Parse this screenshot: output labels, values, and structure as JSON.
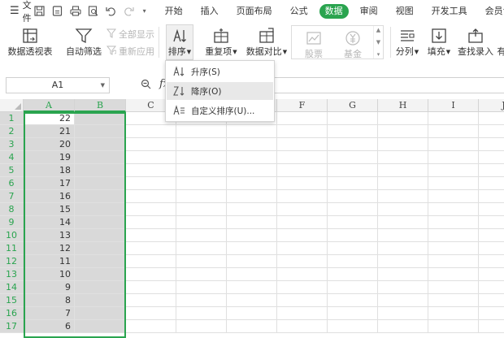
{
  "menubar": {
    "file_label": "文件",
    "tabs": [
      {
        "label": "开始",
        "active": false
      },
      {
        "label": "插入",
        "active": false
      },
      {
        "label": "页面布局",
        "active": false
      },
      {
        "label": "公式",
        "active": false
      },
      {
        "label": "数据",
        "active": true
      },
      {
        "label": "审阅",
        "active": false
      },
      {
        "label": "视图",
        "active": false
      },
      {
        "label": "开发工具",
        "active": false
      },
      {
        "label": "会员专享",
        "active": false
      }
    ],
    "accent_color": "#2aa44f"
  },
  "ribbon": {
    "pivot_table": "数据透视表",
    "auto_filter": "自动筛选",
    "show_all": "全部显示",
    "reapply": "重新应用",
    "sort": "排序",
    "duplicates": "重复项",
    "compare": "数据对比",
    "stocks": "股票",
    "funds": "基金",
    "split": "分列",
    "fill": "填充",
    "find_entry": "查找录入",
    "more": "有"
  },
  "formula_bar": {
    "cell_ref": "A1",
    "fx": "fx",
    "value": ""
  },
  "sort_menu": {
    "items": [
      "升序(S)",
      "降序(O)",
      "自定义排序(U)..."
    ],
    "highlighted_index": 1
  },
  "sheet": {
    "columns": [
      "A",
      "B",
      "C",
      "D",
      "E",
      "F",
      "G",
      "H",
      "I",
      "J"
    ],
    "rows": [
      "1",
      "2",
      "3",
      "4",
      "5",
      "6",
      "7",
      "8",
      "9",
      "10",
      "11",
      "12",
      "13",
      "14",
      "15",
      "16",
      "17"
    ],
    "col_a_values": [
      "22",
      "21",
      "20",
      "19",
      "18",
      "17",
      "16",
      "15",
      "14",
      "13",
      "12",
      "11",
      "10",
      "9",
      "8",
      "7",
      "6"
    ],
    "selected_columns": [
      "A",
      "B"
    ],
    "selection_color": "#2aa44f"
  }
}
